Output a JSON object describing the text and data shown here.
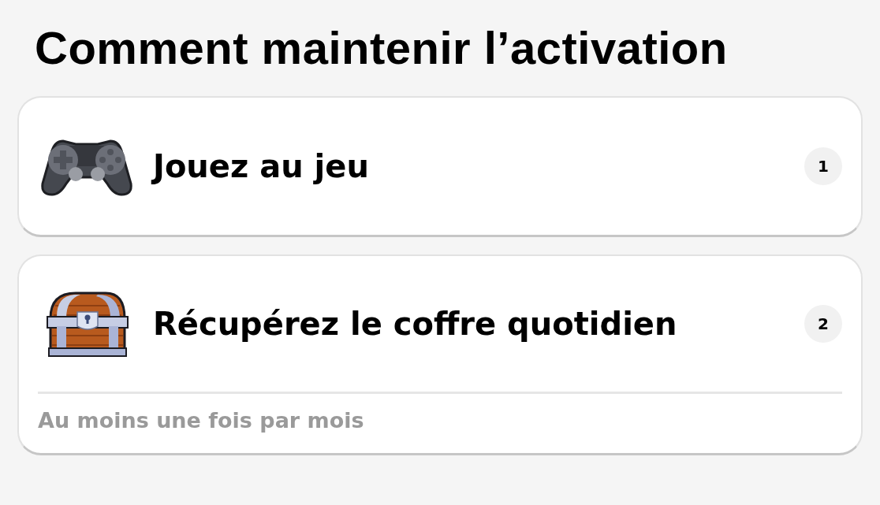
{
  "title": "Comment maintenir l’activation",
  "steps": [
    {
      "kind": "controller",
      "label": "Jouez au jeu",
      "number": "1"
    },
    {
      "kind": "chest",
      "label": "Récupérez le coffre quotidien",
      "number": "2",
      "note": "Au moins une fois par mois"
    }
  ]
}
